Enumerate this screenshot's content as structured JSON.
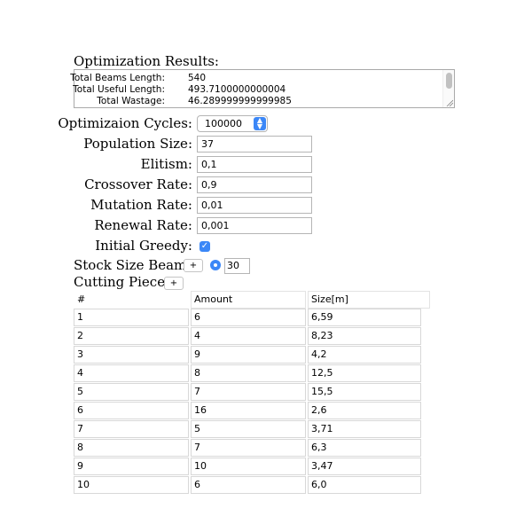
{
  "results": {
    "title": "Optimization Results:",
    "rows": [
      {
        "label": "Total Beams Length:",
        "value": "540"
      },
      {
        "label": "Total Useful Length:",
        "value": "493.7100000000004"
      },
      {
        "label": "Total Wastage:",
        "value": "46.289999999999985"
      }
    ]
  },
  "params": {
    "cycles_label": "Optimizaion Cycles:",
    "cycles_value": "100000",
    "population_label": "Population Size:",
    "population_value": "37",
    "elitism_label": "Elitism:",
    "elitism_value": "0,1",
    "crossover_label": "Crossover Rate:",
    "crossover_value": "0,9",
    "mutation_label": "Mutation Rate:",
    "mutation_value": "0,01",
    "renewal_label": "Renewal Rate:",
    "renewal_value": "0,001",
    "greedy_label": "Initial Greedy:",
    "greedy_checked": true
  },
  "stock": {
    "label": "Stock Size Beams:",
    "add_label": "+",
    "value": "30"
  },
  "pieces": {
    "label": "Cutting Pieces:",
    "add_label": "+",
    "headers": [
      "#",
      "Amount",
      "Size[m]"
    ],
    "rows": [
      [
        "1",
        "6",
        "6,59"
      ],
      [
        "2",
        "4",
        "8,23"
      ],
      [
        "3",
        "9",
        "4,2"
      ],
      [
        "4",
        "8",
        "12,5"
      ],
      [
        "5",
        "7",
        "15,5"
      ],
      [
        "6",
        "16",
        "2,6"
      ],
      [
        "7",
        "5",
        "3,71"
      ],
      [
        "8",
        "7",
        "6,3"
      ],
      [
        "9",
        "10",
        "3,47"
      ],
      [
        "10",
        "6",
        "6,0"
      ]
    ]
  },
  "colors": {
    "accent": "#3b87f7"
  }
}
